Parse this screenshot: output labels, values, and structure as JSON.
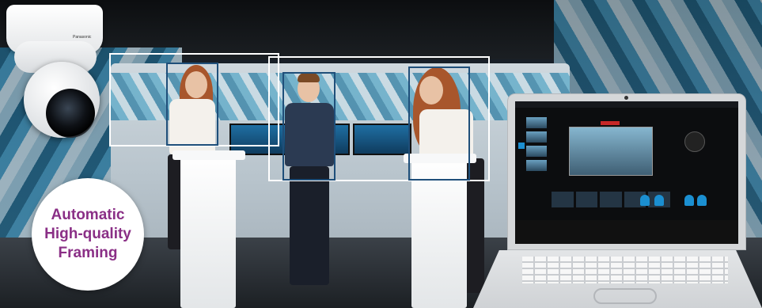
{
  "camera": {
    "brand": "Panasonic"
  },
  "badge": {
    "lines": [
      "Automatic",
      "High-quality",
      "Framing"
    ],
    "color": "#8a2f86"
  },
  "framing": {
    "wide_color": "#ffffff",
    "individual_color": "#1f4f7a"
  }
}
